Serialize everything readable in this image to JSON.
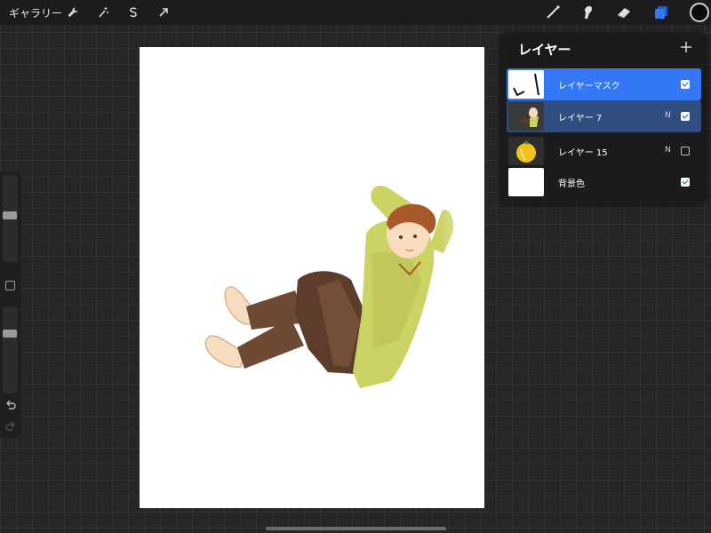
{
  "toolbar": {
    "gallery_label": "ギャラリー",
    "left_icons": [
      "wrench-icon",
      "magic-wand-icon",
      "selection-icon",
      "transform-arrow-icon"
    ],
    "right_icons": [
      "brush-icon",
      "smudge-icon",
      "eraser-icon",
      "layers-icon"
    ],
    "accent_color": "#3478f6",
    "current_color": "#0a0a0a"
  },
  "sidebar": {
    "brush_size_level": 0.48,
    "opacity_level": 0.3
  },
  "layers_panel": {
    "title": "レイヤー",
    "layers": [
      {
        "name": "レイヤーマスク",
        "blend": "",
        "visible": true,
        "state": "selected"
      },
      {
        "name": "レイヤー 7",
        "blend": "N",
        "visible": true,
        "state": "grouped"
      },
      {
        "name": "レイヤー 15",
        "blend": "N",
        "visible": false,
        "state": "normal"
      },
      {
        "name": "背景色",
        "blend": "",
        "visible": true,
        "state": "normal"
      }
    ]
  },
  "canvas": {
    "background_color": "#ffffff",
    "subject": "illustration of a boy in a yellow-green sweater and brown pants reclining with hands behind his head"
  }
}
